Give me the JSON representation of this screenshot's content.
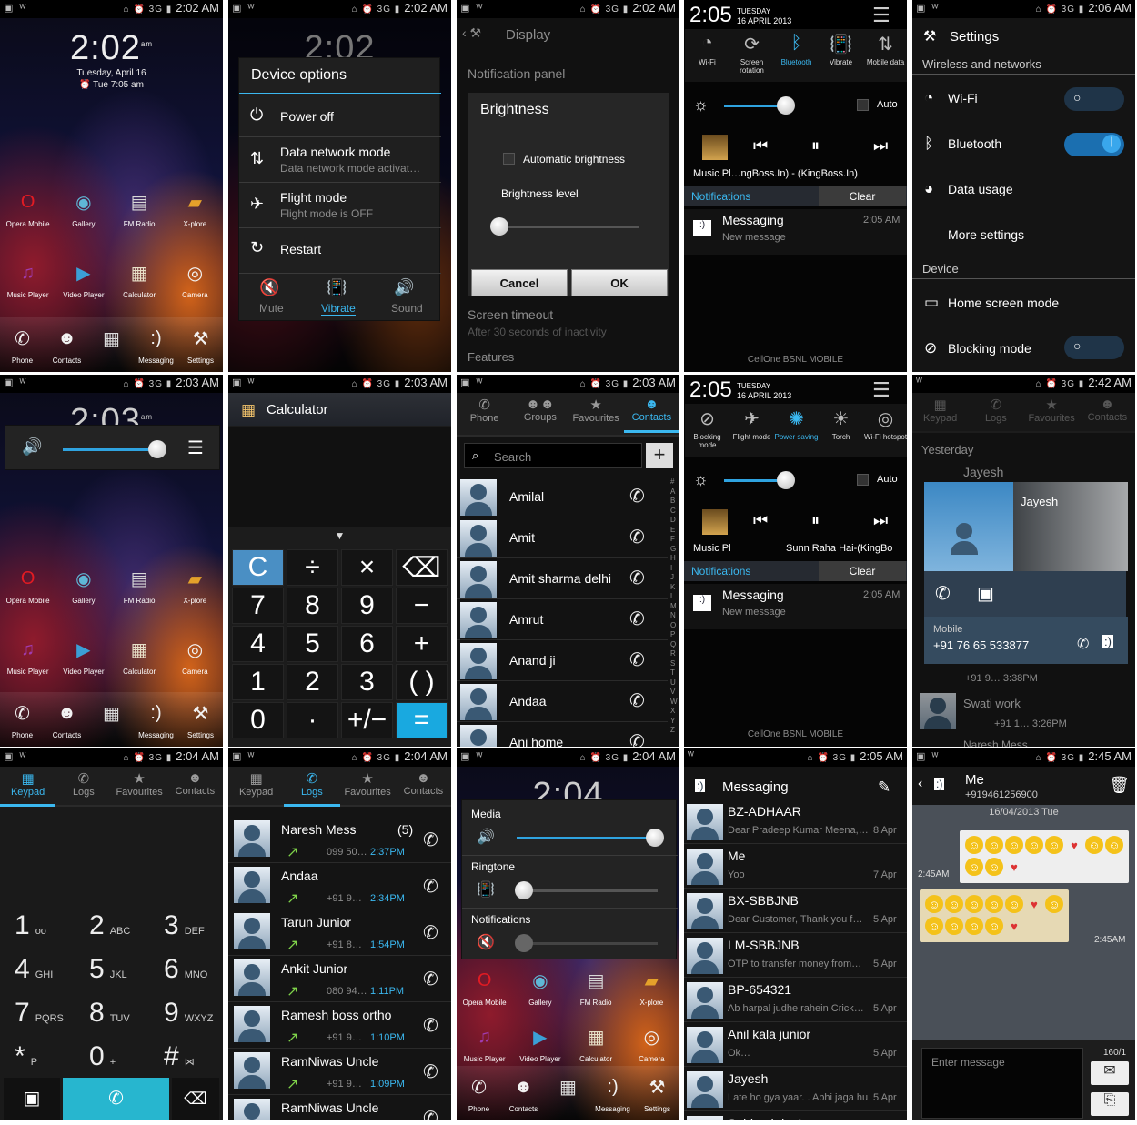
{
  "status": {
    "t1": "2:02 AM",
    "t2": "2:02 AM",
    "t3": "2:02 AM",
    "t5": "2:06 AM",
    "t6": "2:03 AM",
    "t7": "2:03 AM",
    "t8": "2:03 AM",
    "t10": "2:42 AM",
    "t11": "2:04 AM",
    "t12": "2:04 AM",
    "t13": "2:04 AM",
    "t14": "2:05 AM",
    "t15": "2:45 AM",
    "icons": "⌂ ⏰ 3G ▮"
  },
  "home": {
    "time": "2:02",
    "ampm": "am",
    "date": "Tuesday, April 16",
    "alarm": "⏰ Tue 7:05 am",
    "apps_row1": [
      "Opera Mobile",
      "Gallery",
      "FM Radio",
      "X-plore"
    ],
    "apps_row2": [
      "Music Player",
      "Video Player",
      "Calculator",
      "Camera"
    ],
    "dock": [
      "Phone",
      "Contacts",
      "",
      "Messaging",
      "Settings"
    ]
  },
  "device_options": {
    "title": "Device options",
    "power_off": "Power off",
    "data_mode": "Data network mode",
    "data_mode_sub": "Data network mode activat…",
    "flight": "Flight mode",
    "flight_sub": "Flight mode is OFF",
    "restart": "Restart",
    "mute": "Mute",
    "vibrate": "Vibrate",
    "sound": "Sound"
  },
  "display": {
    "header": "Display",
    "section": "Notification panel",
    "dialog_title": "Brightness",
    "auto": "Automatic brightness",
    "level": "Brightness level",
    "cancel": "Cancel",
    "ok": "OK",
    "timeout": "Screen timeout",
    "timeout_sub": "After 30 seconds of inactivity",
    "features": "Features"
  },
  "notif1": {
    "time": "2:05",
    "day": "TUESDAY",
    "date": "16 APRIL 2013",
    "qs": [
      "Wi-Fi",
      "Screen rotation",
      "Bluetooth",
      "Vibrate",
      "Mobile data"
    ],
    "auto": "Auto",
    "music": "Music Pl…ngBoss.In) - (KingBoss.In)",
    "notifications": "Notifications",
    "clear": "Clear",
    "msg_title": "Messaging",
    "msg_sub": "New message",
    "msg_time": "2:05 AM",
    "carrier": "CellOne BSNL MOBILE"
  },
  "settings": {
    "title": "Settings",
    "wireless": "Wireless and networks",
    "wifi": "Wi-Fi",
    "bluetooth": "Bluetooth",
    "data_usage": "Data usage",
    "more": "More settings",
    "device": "Device",
    "home_mode": "Home screen mode",
    "blocking": "Blocking mode"
  },
  "volume_home": {
    "time": "2:03",
    "ampm": "am"
  },
  "calc": {
    "title": "Calculator",
    "keys": [
      "C",
      "÷",
      "×",
      "⌫",
      "7",
      "8",
      "9",
      "−",
      "4",
      "5",
      "6",
      "+",
      "1",
      "2",
      "3",
      "( )",
      "0",
      "·",
      "+/−",
      "="
    ]
  },
  "contacts": {
    "tabs": [
      "Phone",
      "Groups",
      "Favourites",
      "Contacts"
    ],
    "search": "Search",
    "names": [
      "Amilal",
      "Amit",
      "Amit sharma delhi",
      "Amrut",
      "Anand ji",
      "Andaa",
      "Ani home"
    ],
    "index": [
      "#",
      "A",
      "B",
      "C",
      "D",
      "E",
      "F",
      "G",
      "H",
      "I",
      "J",
      "K",
      "L",
      "M",
      "N",
      "O",
      "P",
      "Q",
      "R",
      "S",
      "T",
      "U",
      "V",
      "W",
      "X",
      "Y",
      "Z"
    ]
  },
  "notif2": {
    "time": "2:05",
    "day": "TUESDAY",
    "date": "16 APRIL 2013",
    "qs": [
      "Blocking mode",
      "Flight mode",
      "Power saving",
      "Torch",
      "Wi-Fi hotspot"
    ],
    "auto": "Auto",
    "music_l": "Music Pl",
    "music_r": "Sunn Raha Hai-(KingBo",
    "notifications": "Notifications",
    "clear": "Clear",
    "msg_title": "Messaging",
    "msg_sub": "New message",
    "msg_time": "2:05 AM",
    "carrier": "CellOne BSNL MOBILE"
  },
  "logs_popup": {
    "tabs": [
      "Keypad",
      "Logs",
      "Favourites",
      "Contacts"
    ],
    "yesterday": "Yesterday",
    "name": "Jayesh",
    "mobile_label": "Mobile",
    "number": "+91 76 65 533877",
    "row1": "+91 9… 3:38PM",
    "row2_name": "Swati work",
    "row2": "+91 1… 3:26PM",
    "row3": "Naresh Mess"
  },
  "dialer": {
    "tabs": [
      "Keypad",
      "Logs",
      "Favourites",
      "Contacts"
    ],
    "keys": [
      [
        "1",
        "oo"
      ],
      [
        "2",
        "ABC"
      ],
      [
        "3",
        "DEF"
      ],
      [
        "4",
        "GHI"
      ],
      [
        "5",
        "JKL"
      ],
      [
        "6",
        "MNO"
      ],
      [
        "7",
        "PQRS"
      ],
      [
        "8",
        "TUV"
      ],
      [
        "9",
        "WXYZ"
      ],
      [
        "*",
        "P"
      ],
      [
        "0",
        "+"
      ],
      [
        "#",
        "⋈"
      ]
    ]
  },
  "logs": {
    "tabs": [
      "Keypad",
      "Logs",
      "Favourites",
      "Contacts"
    ],
    "entries": [
      {
        "name": "Naresh Mess",
        "count": "(5)",
        "num": "099 50…",
        "time": "2:37PM"
      },
      {
        "name": "Andaa",
        "count": "",
        "num": "+91 9…",
        "time": "2:34PM"
      },
      {
        "name": "Tarun Junior",
        "count": "",
        "num": "+91 8…",
        "time": "1:54PM"
      },
      {
        "name": "Ankit Junior",
        "count": "",
        "num": "080 94…",
        "time": "1:11PM"
      },
      {
        "name": "Ramesh boss ortho",
        "count": "",
        "num": "+91 9…",
        "time": "1:10PM"
      },
      {
        "name": "RamNiwas Uncle",
        "count": "",
        "num": "+91 9…",
        "time": "1:09PM"
      },
      {
        "name": "RamNiwas Uncle",
        "count": "",
        "num": "",
        "time": ""
      }
    ]
  },
  "volume_panel": {
    "media": "Media",
    "ringtone": "Ringtone",
    "notifications": "Notifications",
    "apps_row1": [
      "Opera Mobile",
      "Gallery",
      "FM Radio",
      "X-plore"
    ],
    "apps_row2": [
      "Music Player",
      "Video Player",
      "Calculator",
      "Camera"
    ],
    "dock": [
      "Phone",
      "Contacts",
      "",
      "Messaging",
      "Settings"
    ]
  },
  "messaging": {
    "title": "Messaging",
    "threads": [
      {
        "name": "BZ-ADHAAR",
        "preview": "Dear Pradeep Kumar Meena,…",
        "date": "8 Apr"
      },
      {
        "name": "Me",
        "preview": "Yoo",
        "date": "7 Apr"
      },
      {
        "name": "BX-SBBJNB",
        "preview": "Dear Customer, Thank you f…",
        "date": "5 Apr"
      },
      {
        "name": "LM-SBBJNB",
        "preview": "OTP to transfer money from…",
        "date": "5 Apr"
      },
      {
        "name": "BP-654321",
        "preview": "Ab harpal judhe rahein Crick…",
        "date": "5 Apr"
      },
      {
        "name": "Anil kala junior",
        "preview": "Ok…",
        "date": "5 Apr"
      },
      {
        "name": "Jayesh",
        "preview": "Late ho gya yaar. . Abhi jaga hu",
        "date": "5 Apr"
      },
      {
        "name": "Subhash junior",
        "preview": "",
        "date": ""
      }
    ]
  },
  "conversation": {
    "name": "Me",
    "number": "+919461256900",
    "day": "16/04/2013 Tue",
    "t_in": "2:45AM",
    "t_out": "2:45AM",
    "placeholder": "Enter message",
    "counter": "160/1"
  }
}
